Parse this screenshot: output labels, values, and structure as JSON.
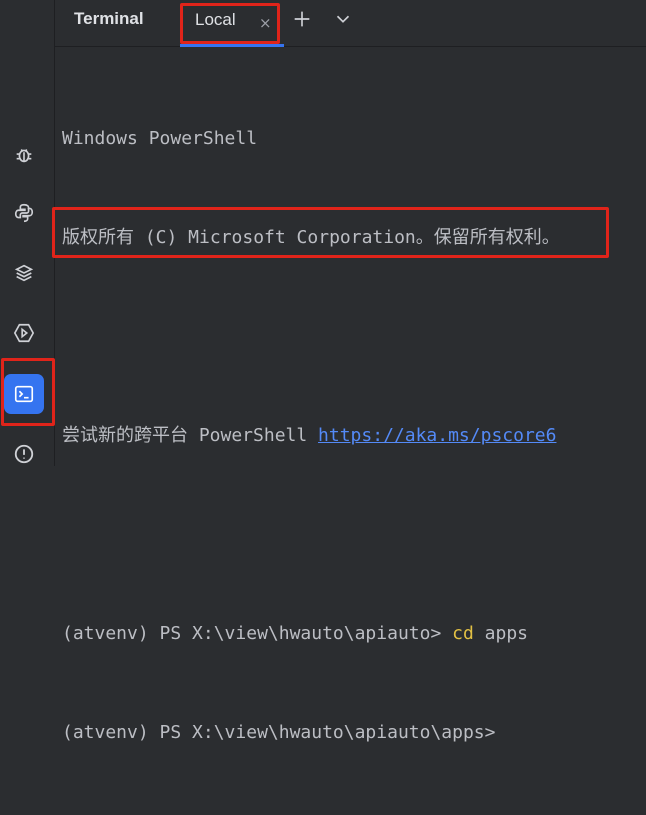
{
  "panel_title": "Terminal",
  "tabs": [
    {
      "label": "Local",
      "close": "×",
      "active": true
    }
  ],
  "toolbar": {
    "add": "+",
    "more": "⌄"
  },
  "terminal": {
    "line1": "Windows PowerShell",
    "line2": "版权所有 (C) Microsoft Corporation。保留所有权利。",
    "line3_prefix": "尝试新的跨平台 PowerShell ",
    "line3_link": "https://aka.ms/pscore6",
    "line4_prompt": "(atvenv) PS X:\\view\\hwauto\\apiauto> ",
    "line4_cmd": "cd",
    "line4_arg": " apps",
    "line5_prompt": "(atvenv) PS X:\\view\\hwauto\\apiauto\\apps>"
  },
  "sidebar": {
    "items": [
      "debug-icon",
      "python-console-icon",
      "layers-icon",
      "services-icon",
      "terminal-icon",
      "problems-icon"
    ]
  },
  "colors": {
    "accent": "#3574f0",
    "highlight": "#e0241a",
    "link": "#548af7",
    "command": "#e2c044"
  }
}
